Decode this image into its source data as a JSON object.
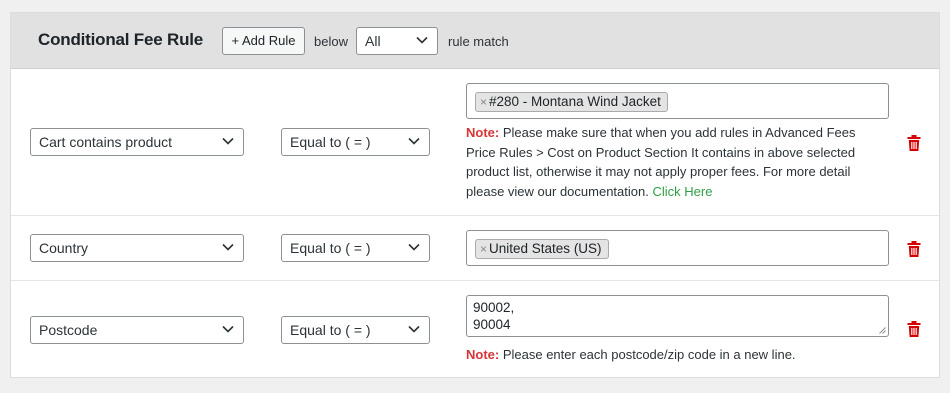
{
  "header": {
    "title": "Conditional Fee Rule",
    "add_rule_label": "+ Add Rule",
    "below_label": "below",
    "match_select": "All",
    "rule_match_label": "rule match"
  },
  "rules": [
    {
      "condition": "Cart contains product",
      "operator": "Equal to ( = )",
      "tag": "#280 - Montana Wind Jacket",
      "note_label": "Note:",
      "note_lines": [
        "Please make sure that when you add rules in Advanced Fees",
        "Price Rules > Cost on Product Section It contains in above selected",
        "product list, otherwise it may not apply proper fees. For more detail",
        "please view our documentation."
      ],
      "note_link": "Click Here"
    },
    {
      "condition": "Country",
      "operator": "Equal to ( = )",
      "tag": "United States (US)"
    },
    {
      "condition": "Postcode",
      "operator": "Equal to ( = )",
      "textarea_lines": [
        "90002,",
        "90004"
      ],
      "note_label": "Note:",
      "note_text": "Please enter each postcode/zip code in a new line."
    }
  ],
  "icons": {
    "remove_tag": "×",
    "delete": "trash-icon",
    "dropdown": "chevron-down-icon"
  },
  "colors": {
    "header_bg": "#e1e1e1",
    "note_label": "#d63638",
    "link": "#2e9e46",
    "delete_icon": "#d60000"
  }
}
